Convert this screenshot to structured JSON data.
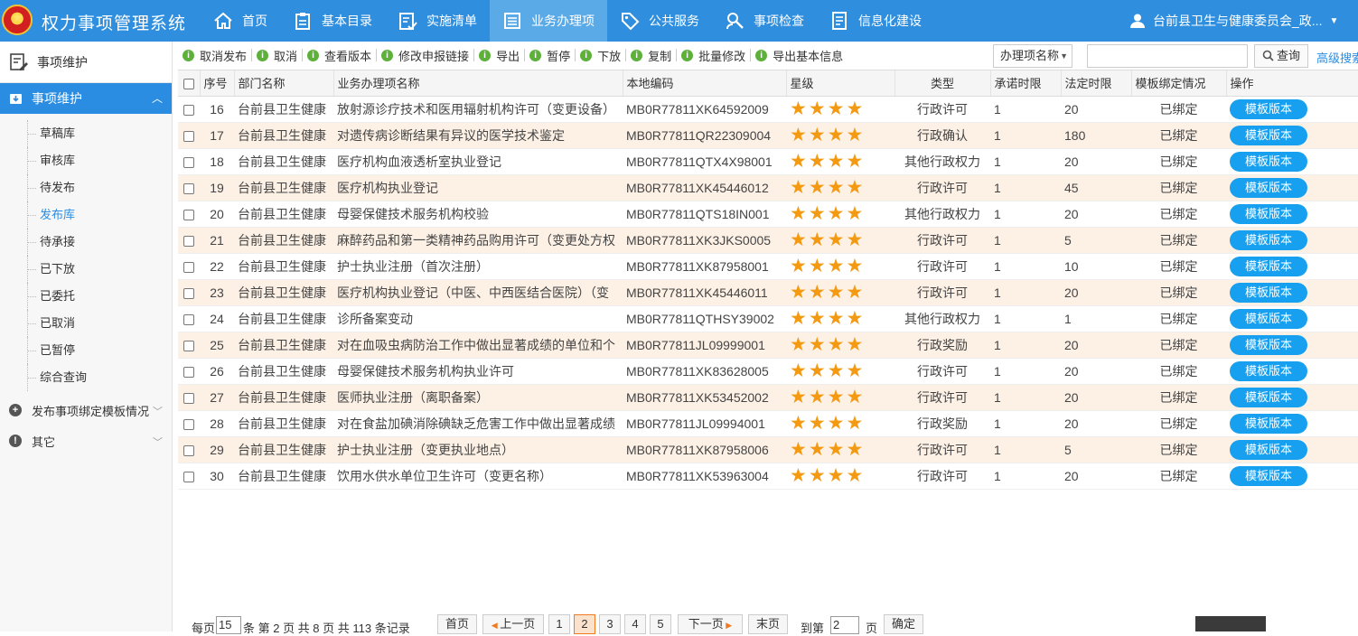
{
  "app": {
    "title": "权力事项管理系统",
    "user": "台前县卫生与健康委员会_政..."
  },
  "nav": [
    {
      "label": "首页",
      "icon": "home-icon"
    },
    {
      "label": "基本目录",
      "icon": "clipboard-icon"
    },
    {
      "label": "实施清单",
      "icon": "checklist-icon"
    },
    {
      "label": "业务办理项",
      "icon": "list-icon",
      "active": true
    },
    {
      "label": "公共服务",
      "icon": "tag-icon"
    },
    {
      "label": "事项检查",
      "icon": "inspect-icon"
    },
    {
      "label": "信息化建设",
      "icon": "document-icon"
    }
  ],
  "sidebar": {
    "head": "事项维护",
    "group": "事项维护",
    "items": [
      "草稿库",
      "审核库",
      "待发布",
      "发布库",
      "待承接",
      "已下放",
      "已委托",
      "已取消",
      "已暂停",
      "综合查询"
    ],
    "active_item": "发布库",
    "categories": [
      "发布事项绑定模板情况",
      "其它"
    ]
  },
  "toolbar": {
    "buttons": [
      "取消发布",
      "取消",
      "查看版本",
      "修改申报链接",
      "导出",
      "暂停",
      "下放",
      "复制",
      "批量修改",
      "导出基本信息"
    ],
    "select_label": "办理项名称",
    "search_value": "",
    "search_button": "查询",
    "advanced": "高级搜索"
  },
  "table": {
    "headers": [
      "序号",
      "部门名称",
      "业务办理项名称",
      "本地编码",
      "星级",
      "类型",
      "承诺时限",
      "法定时限",
      "模板绑定情况",
      "操作"
    ],
    "rows": [
      {
        "no": "16",
        "dept": "台前县卫生健康",
        "name": "放射源诊疗技术和医用辐射机构许可（变更设备）",
        "code": "MB0R77811XK64592009",
        "stars": 4,
        "type": "行政许可",
        "promise": "1",
        "legal": "20",
        "binding": "已绑定",
        "action": "模板版本"
      },
      {
        "no": "17",
        "dept": "台前县卫生健康",
        "name": "对遗传病诊断结果有异议的医学技术鉴定",
        "code": "MB0R77811QR22309004",
        "stars": 4,
        "type": "行政确认",
        "promise": "1",
        "legal": "180",
        "binding": "已绑定",
        "action": "模板版本"
      },
      {
        "no": "18",
        "dept": "台前县卫生健康",
        "name": "医疗机构血液透析室执业登记",
        "code": "MB0R77811QTX4X98001",
        "stars": 4,
        "type": "其他行政权力",
        "promise": "1",
        "legal": "20",
        "binding": "已绑定",
        "action": "模板版本"
      },
      {
        "no": "19",
        "dept": "台前县卫生健康",
        "name": "医疗机构执业登记",
        "code": "MB0R77811XK45446012",
        "stars": 4,
        "type": "行政许可",
        "promise": "1",
        "legal": "45",
        "binding": "已绑定",
        "action": "模板版本"
      },
      {
        "no": "20",
        "dept": "台前县卫生健康",
        "name": "母婴保健技术服务机构校验",
        "code": "MB0R77811QTS18IN001",
        "stars": 4,
        "type": "其他行政权力",
        "promise": "1",
        "legal": "20",
        "binding": "已绑定",
        "action": "模板版本"
      },
      {
        "no": "21",
        "dept": "台前县卫生健康",
        "name": "麻醉药品和第一类精神药品购用许可（变更处方权",
        "code": "MB0R77811XK3JKS0005",
        "stars": 4,
        "type": "行政许可",
        "promise": "1",
        "legal": "5",
        "binding": "已绑定",
        "action": "模板版本"
      },
      {
        "no": "22",
        "dept": "台前县卫生健康",
        "name": "护士执业注册（首次注册）",
        "code": "MB0R77811XK87958001",
        "stars": 4,
        "type": "行政许可",
        "promise": "1",
        "legal": "10",
        "binding": "已绑定",
        "action": "模板版本"
      },
      {
        "no": "23",
        "dept": "台前县卫生健康",
        "name": "医疗机构执业登记（中医、中西医结合医院）（变",
        "code": "MB0R77811XK45446011",
        "stars": 4,
        "type": "行政许可",
        "promise": "1",
        "legal": "20",
        "binding": "已绑定",
        "action": "模板版本"
      },
      {
        "no": "24",
        "dept": "台前县卫生健康",
        "name": "诊所备案变动",
        "code": "MB0R77811QTHSY39002",
        "stars": 4,
        "type": "其他行政权力",
        "promise": "1",
        "legal": "1",
        "binding": "已绑定",
        "action": "模板版本"
      },
      {
        "no": "25",
        "dept": "台前县卫生健康",
        "name": "对在血吸虫病防治工作中做出显著成绩的单位和个",
        "code": "MB0R77811JL09999001",
        "stars": 4,
        "type": "行政奖励",
        "promise": "1",
        "legal": "20",
        "binding": "已绑定",
        "action": "模板版本"
      },
      {
        "no": "26",
        "dept": "台前县卫生健康",
        "name": "母婴保健技术服务机构执业许可",
        "code": "MB0R77811XK83628005",
        "stars": 4,
        "type": "行政许可",
        "promise": "1",
        "legal": "20",
        "binding": "已绑定",
        "action": "模板版本"
      },
      {
        "no": "27",
        "dept": "台前县卫生健康",
        "name": "医师执业注册（离职备案）",
        "code": "MB0R77811XK53452002",
        "stars": 4,
        "type": "行政许可",
        "promise": "1",
        "legal": "20",
        "binding": "已绑定",
        "action": "模板版本"
      },
      {
        "no": "28",
        "dept": "台前县卫生健康",
        "name": "对在食盐加碘消除碘缺乏危害工作中做出显著成绩",
        "code": "MB0R77811JL09994001",
        "stars": 4,
        "type": "行政奖励",
        "promise": "1",
        "legal": "20",
        "binding": "已绑定",
        "action": "模板版本"
      },
      {
        "no": "29",
        "dept": "台前县卫生健康",
        "name": "护士执业注册（变更执业地点）",
        "code": "MB0R77811XK87958006",
        "stars": 4,
        "type": "行政许可",
        "promise": "1",
        "legal": "5",
        "binding": "已绑定",
        "action": "模板版本"
      },
      {
        "no": "30",
        "dept": "台前县卫生健康",
        "name": "饮用水供水单位卫生许可（变更名称）",
        "code": "MB0R77811XK53963004",
        "stars": 4,
        "type": "行政许可",
        "promise": "1",
        "legal": "20",
        "binding": "已绑定",
        "action": "模板版本"
      }
    ]
  },
  "pager": {
    "per_page_prefix": "每页",
    "per_page": "15",
    "summary": "条 第 2 页 共 8 页 共 113 条记录",
    "first": "首页",
    "prev": "上一页",
    "pages": [
      "1",
      "2",
      "3",
      "4",
      "5"
    ],
    "current": "2",
    "next": "下一页",
    "last": "末页",
    "goto_prefix": "到第",
    "goto_value": "2",
    "goto_suffix": "页",
    "confirm": "确定"
  }
}
